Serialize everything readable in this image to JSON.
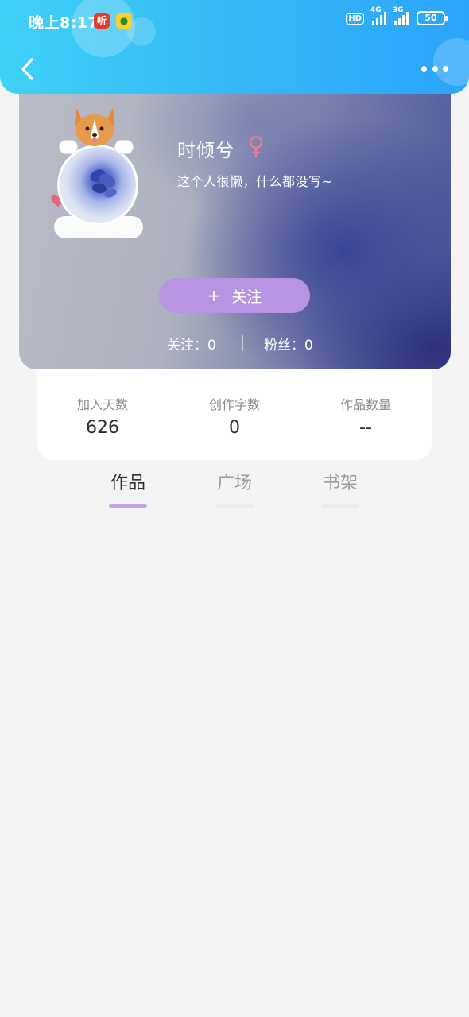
{
  "status_bar": {
    "time": "晚上8:17",
    "app_icons": [
      "ting-app-icon",
      "lemon-app-icon"
    ],
    "hd_label": "HD",
    "network_1": "4G",
    "network_2": "3G",
    "battery": "50"
  },
  "nav": {
    "back_icon": "chevron-left-icon",
    "more_icon": "more-dots-icon"
  },
  "profile": {
    "username": "时倾兮",
    "gender_symbol": "♀",
    "bio": "这个人很懒，什么都没写~",
    "follow_plus": "+",
    "follow_label": "关注",
    "following": "关注：0",
    "fans": "粉丝：0"
  },
  "stats": {
    "days_label": "加入天数",
    "days_value": "626",
    "words_label": "创作字数",
    "words_value": "0",
    "works_label": "作品数量",
    "works_value": "--"
  },
  "tabs": [
    {
      "label": "作品",
      "active": true
    },
    {
      "label": "广场",
      "active": false
    },
    {
      "label": "书架",
      "active": false
    }
  ],
  "colors": {
    "header_gradient_start": "#3fd1f6",
    "header_gradient_end": "#2aa5fb",
    "follow_button": "#b694e2",
    "active_tab_indicator": "#c3a4e6",
    "gender_icon": "#f07a9a"
  }
}
